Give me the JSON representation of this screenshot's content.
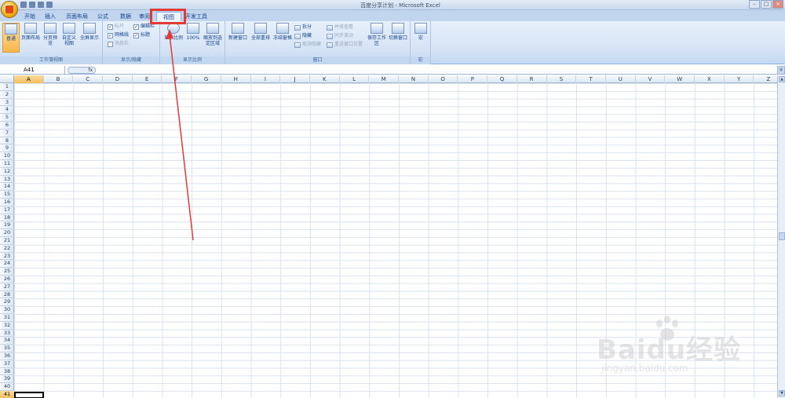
{
  "window": {
    "title": "百度分享计划 - Microsoft Excel",
    "controls": [
      "–",
      "□",
      "×"
    ]
  },
  "tabs": [
    {
      "label": "开始",
      "active": false
    },
    {
      "label": "插入",
      "active": false
    },
    {
      "label": "页面布局",
      "active": false
    },
    {
      "label": "公式",
      "active": false
    },
    {
      "label": "数据",
      "active": false
    },
    {
      "label": "审阅",
      "active": false
    },
    {
      "label": "视图",
      "active": true
    },
    {
      "label": "开发工具",
      "active": false
    }
  ],
  "ribbon": {
    "workbook_views": {
      "label": "工作簿视图",
      "buttons": [
        "普通",
        "页面布局",
        "分页预览",
        "自定义视图",
        "全屏显示"
      ]
    },
    "show_hide": {
      "label": "显示/隐藏",
      "checks": [
        {
          "label": "标尺",
          "checked": true,
          "disabled": true
        },
        {
          "label": "网格线",
          "checked": true,
          "disabled": false
        },
        {
          "label": "消息栏",
          "checked": false,
          "disabled": true
        },
        {
          "label": "编辑栏",
          "checked": true,
          "disabled": false
        },
        {
          "label": "标题",
          "checked": true,
          "disabled": false
        }
      ]
    },
    "zoom": {
      "label": "显示比例",
      "buttons": [
        "显示比例",
        "100%",
        "缩放到选定区域"
      ]
    },
    "window": {
      "label": "窗口",
      "buttons": [
        "新建窗口",
        "全部重排",
        "冻结窗格"
      ],
      "small_buttons": [
        "拆分",
        "隐藏",
        "取消隐藏"
      ],
      "small_buttons2": [
        "并排查看",
        "同步滚动",
        "重设窗口位置"
      ],
      "big_buttons": [
        "保存工作区",
        "切换窗口"
      ]
    },
    "macro": {
      "label": "宏",
      "button": "宏"
    }
  },
  "formula_bar": {
    "name_box": "A41",
    "fx_label": "fx",
    "formula": ""
  },
  "grid": {
    "columns": [
      "A",
      "B",
      "C",
      "D",
      "E",
      "F",
      "G",
      "H",
      "I",
      "J",
      "K",
      "L",
      "M",
      "N",
      "O",
      "P",
      "Q",
      "R",
      "S",
      "T",
      "U",
      "V",
      "W",
      "X",
      "Y",
      "Z"
    ],
    "rows": [
      "1",
      "2",
      "3",
      "4",
      "5",
      "6",
      "7",
      "8",
      "9",
      "10",
      "11",
      "12",
      "13",
      "14",
      "15",
      "16",
      "17",
      "18",
      "19",
      "20",
      "21",
      "22",
      "23",
      "24",
      "25",
      "26",
      "27",
      "28",
      "29",
      "30",
      "31",
      "32",
      "33",
      "34",
      "35",
      "36",
      "37",
      "38",
      "39",
      "40",
      "41"
    ],
    "selected_column": "A",
    "selected_row": "41"
  },
  "watermark": {
    "brand": "Baidu经验",
    "url": "jingyan.baidu.com"
  },
  "colors": {
    "highlight": "#e53935",
    "ribbon": "#d4e3f5"
  }
}
